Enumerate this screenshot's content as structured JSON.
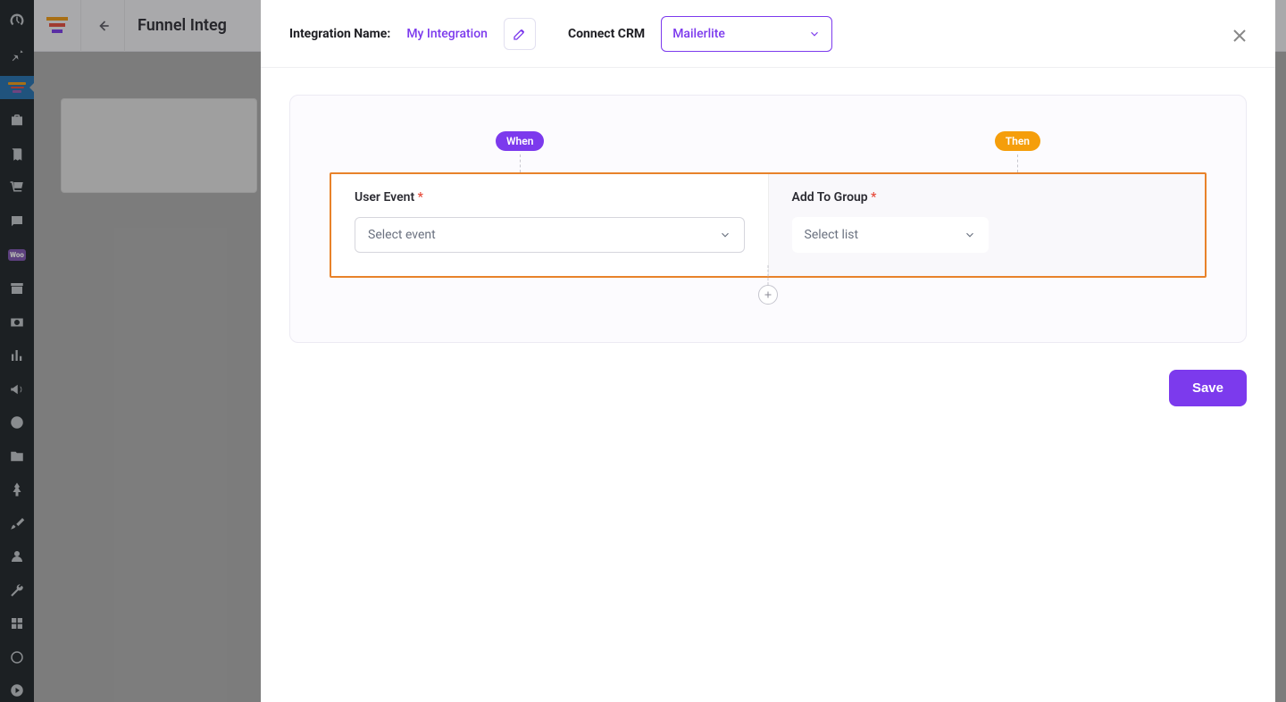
{
  "page": {
    "title": "Funnel Integ"
  },
  "modal": {
    "name_label": "Integration Name:",
    "name_value": "My Integration",
    "crm_label": "Connect CRM",
    "crm_value": "Mailerlite",
    "when_badge": "When",
    "then_badge": "Then",
    "user_event_label": "User Event",
    "user_event_placeholder": "Select event",
    "add_to_group_label": "Add To Group",
    "add_to_group_placeholder": "Select list",
    "save_label": "Save"
  },
  "sidebar_icons": [
    "dashboard-icon",
    "pin-icon",
    "funnel-icon",
    "briefcase-icon",
    "book-icon",
    "cart-icon",
    "chat-icon",
    "woo-icon",
    "archive-icon",
    "money-icon",
    "stats-icon",
    "megaphone-icon",
    "elementor-icon",
    "folder-icon",
    "pushpin-icon",
    "brush-icon",
    "user-icon",
    "wrench-icon",
    "collapse-icon",
    "circle-icon",
    "play-icon"
  ]
}
